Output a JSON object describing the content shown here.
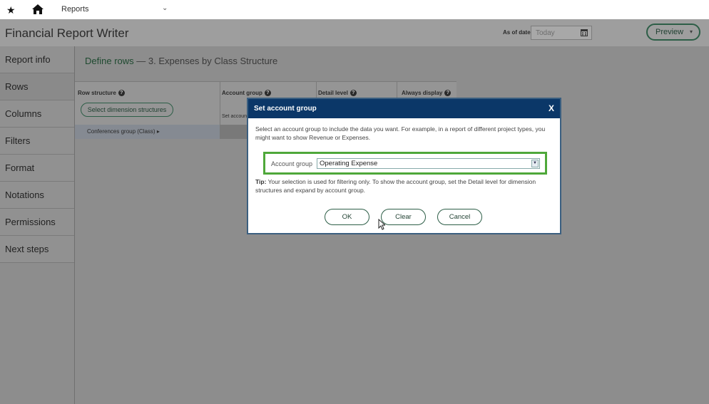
{
  "topnav": {
    "star_icon": "star-icon",
    "home_icon": "home-icon",
    "reports_label": "Reports",
    "dropdown_icon": "chevron-down-icon"
  },
  "appbar": {
    "title": "Financial Report Writer",
    "as_of_label": "As of date",
    "date_placeholder": "Today",
    "preview_label": "Preview"
  },
  "sidebar": {
    "items": [
      {
        "label": "Report info"
      },
      {
        "label": "Rows"
      },
      {
        "label": "Columns"
      },
      {
        "label": "Filters"
      },
      {
        "label": "Format"
      },
      {
        "label": "Notations"
      },
      {
        "label": "Permissions"
      },
      {
        "label": "Next steps"
      }
    ]
  },
  "main": {
    "heading": "Define rows",
    "heading_sub": "— 3. Expenses by Class Structure",
    "columns": {
      "row_structure": "Row structure",
      "account_group": "Account group",
      "detail_level": "Detail level",
      "always_display": "Always display"
    },
    "select_dimension_button": "Select dimension structures",
    "set_account_partial": "Set accoun",
    "row1_label": "Conferences group (Class) ▸"
  },
  "modal": {
    "title": "Set account group",
    "close_label": "X",
    "description": "Select an account group to include the data you want. For example, in a report of different project types, you might want to show Revenue or Expenses.",
    "account_group_label": "Account group",
    "account_group_value": "Operating Expense",
    "tip_label": "Tip:",
    "tip_text": " Your selection is used for filtering only. To show the account group, set the Detail level for dimension structures and expand by account group.",
    "ok_label": "OK",
    "clear_label": "Clear",
    "cancel_label": "Cancel"
  },
  "colors": {
    "modal_header": "#0b3768",
    "highlight_border": "#4fa83a",
    "button_border": "#2d5e47"
  }
}
